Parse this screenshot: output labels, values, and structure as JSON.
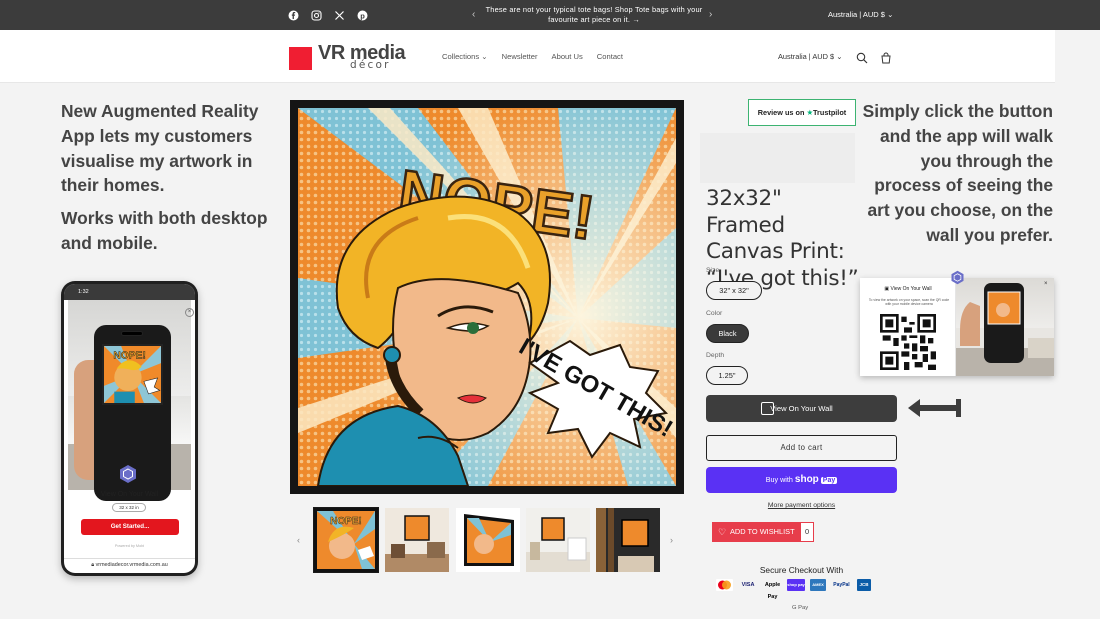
{
  "announcement": {
    "social_icons": [
      "facebook-icon",
      "instagram-icon",
      "x-icon",
      "pinterest-icon"
    ],
    "message": "These are not your typical tote bags! Shop Tote bags with your favourite art piece on it. →",
    "locale": "Australia | AUD $"
  },
  "header": {
    "logo_main": "VR media",
    "logo_sub": "décor",
    "nav": [
      "Collections",
      "Newsletter",
      "About Us",
      "Contact"
    ],
    "locale": "Australia | AUD $"
  },
  "promo_left": {
    "line1": "New Augmented Reality App lets my customers visualise my artwork in their homes.",
    "line2": "Works with both desktop and mobile."
  },
  "promo_right": {
    "text": "Simply click the button and the app will walk you through the process of seeing the art you choose, on the wall you prefer."
  },
  "phone": {
    "time": "1:32",
    "title": "View On Your Wall",
    "size": "32 x 32 in",
    "cta": "Get Started...",
    "powered": "Powered by Mobi",
    "url": "vrmediadecor.vrmedia.com.au"
  },
  "artwork": {
    "headline": "NOPE!",
    "bubble": "I'VE GOT THIS!"
  },
  "product": {
    "trustpilot_prefix": "Review us on",
    "trustpilot_brand": "Trustpilot",
    "title_line1": "32x32\" Framed",
    "title_line2": "Canvas Print:",
    "title_line3": "“I've got this!”",
    "size_label": "Size",
    "size_value": "32\" x 32\"",
    "color_label": "Color",
    "color_value": "Black",
    "depth_label": "Depth",
    "depth_value": "1.25\"",
    "view_on_wall": "View On Your Wall",
    "add_to_cart": "Add to cart",
    "buy_with": "Buy with",
    "shop": "shop",
    "pay": "Pay",
    "more_payment": "More payment options",
    "wishlist": "ADD TO WISHLIST",
    "wishlist_count": "0",
    "secure_checkout": "Secure Checkout With",
    "payment_methods": [
      "Mastercard",
      "VISA",
      "Apple Pay",
      "shop pay",
      "AMEX",
      "PayPal",
      "JCB"
    ],
    "gpay": "G Pay"
  },
  "popup": {
    "title": "View On Your Wall",
    "desc": "To view the artwork on your space, scan the QR code with your mobile device camera"
  },
  "colors": {
    "accent_red": "#f01e32",
    "shop_pay": "#5a31f4",
    "wishlist": "#e73d4b",
    "trustpilot_green": "#00b67a"
  }
}
